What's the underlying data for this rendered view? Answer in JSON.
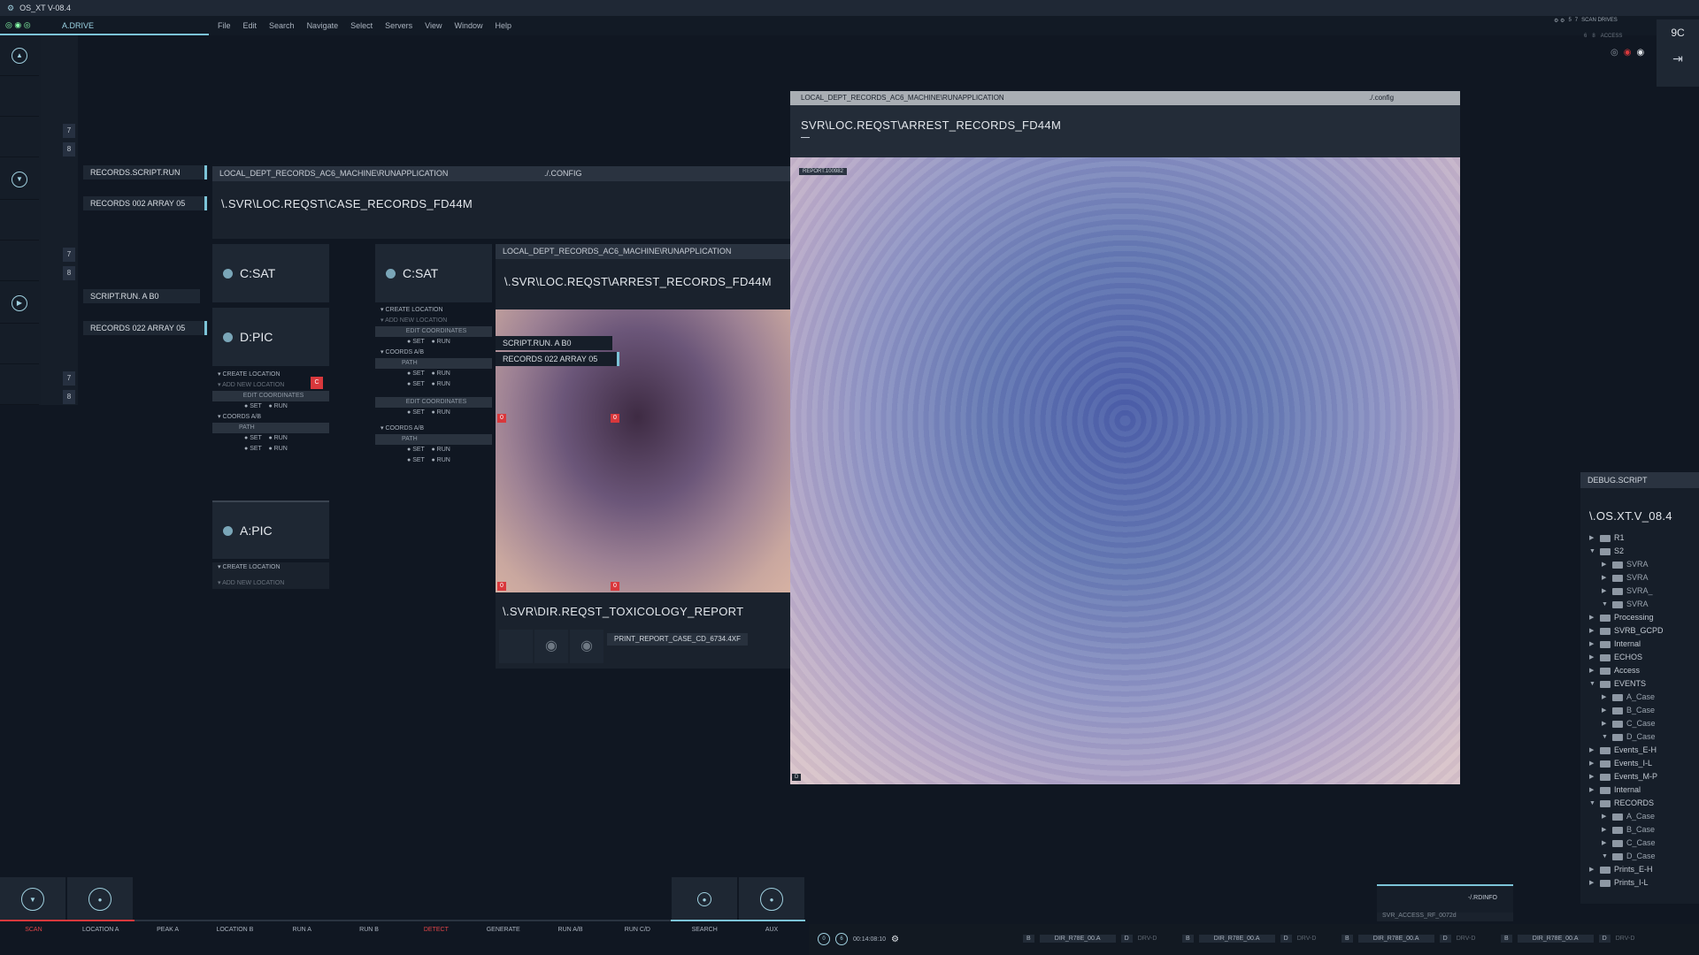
{
  "app": {
    "title": "OS_XT V-08.4",
    "drive": "A.DRIVE",
    "counter": "9C"
  },
  "menu": [
    "File",
    "Edit",
    "Search",
    "Navigate",
    "Select",
    "Servers",
    "View",
    "Window",
    "Help"
  ],
  "rail": {
    "numbers": [
      "7",
      "8",
      "7",
      "8",
      "7",
      "8"
    ],
    "icons": [
      "triangle-up-icon",
      "triangle-down-icon",
      "play-icon"
    ]
  },
  "tags": [
    "RECORDS.SCRIPT.RUN",
    "RECORDS 002 ARRAY 05",
    "SCRIPT.RUN. A B0",
    "RECORDS 022 ARRAY 05"
  ],
  "panelA": {
    "path": "LOCAL_DEPT_RECORDS_AC6_MACHINE\\RUNAPPLICATION",
    "config": "./.CONFIG",
    "title": "\\.SVR\\LOC.REQST\\CASE_RECORDS_FD44M"
  },
  "drives": [
    "C:SAT",
    "D:PIC",
    "A:PIC",
    "C:SAT"
  ],
  "controls": {
    "create": "CREATE LOCATION",
    "add": "ADD NEW LOCATION",
    "edit": "EDIT COORDINATES",
    "set": "SET",
    "run": "RUN",
    "coords": "COORDS A/B",
    "path": "PATH",
    "c": "C"
  },
  "panelB": {
    "path": "LOCAL_DEPT_RECORDS_AC6_MACHINE\\RUNAPPLICATION",
    "title": "\\.SVR\\LOC.REQST\\ARREST_RECORDS_FD44M",
    "tag1": "SCRIPT.RUN. A B0",
    "tag2": "RECORDS 022 ARRAY 05",
    "zero": "0"
  },
  "tox": {
    "title": "\\.SVR\\DIR.REQST_TOXICOLOGY_REPORT",
    "file": "PRINT_REPORT_CASE_CD_6734.4XF"
  },
  "viewer": {
    "path": "LOCAL_DEPT_RECORDS_AC6_MACHINE\\RUNAPPLICATION",
    "config": "./.config",
    "title": "SVR\\LOC.REQST\\ARREST_RECORDS_FD44M",
    "tag": "REPORT.100982",
    "d": "D"
  },
  "top_right": {
    "scan": "SCAN DRIVES",
    "access": "ACCESS",
    "n": [
      "5",
      "7",
      "6",
      "8"
    ]
  },
  "debug": {
    "label": "DEBUG.SCRIPT",
    "title": "\\.OS.XT.V_08.4"
  },
  "tree": [
    {
      "l": 0,
      "t": "▶",
      "n": "R1"
    },
    {
      "l": 0,
      "t": "▼",
      "n": "S2"
    },
    {
      "l": 1,
      "t": "▶",
      "n": "SVRA"
    },
    {
      "l": 1,
      "t": "▶",
      "n": "SVRA"
    },
    {
      "l": 1,
      "t": "▶",
      "n": "SVRA_"
    },
    {
      "l": 1,
      "t": "▼",
      "n": "SVRA"
    },
    {
      "l": 0,
      "t": "▶",
      "n": "Processing"
    },
    {
      "l": 0,
      "t": "▶",
      "n": "SVRB_GCPD"
    },
    {
      "l": 0,
      "t": "▶",
      "n": "Internal"
    },
    {
      "l": 0,
      "t": "▶",
      "n": "ECHOS"
    },
    {
      "l": 0,
      "t": "▶",
      "n": "Access"
    },
    {
      "l": 0,
      "t": "▼",
      "n": "EVENTS"
    },
    {
      "l": 1,
      "t": "▶",
      "n": "A_Case"
    },
    {
      "l": 1,
      "t": "▶",
      "n": "B_Case"
    },
    {
      "l": 1,
      "t": "▶",
      "n": "C_Case"
    },
    {
      "l": 1,
      "t": "▼",
      "n": "D_Case"
    },
    {
      "l": 0,
      "t": "▶",
      "n": "Events_E-H"
    },
    {
      "l": 0,
      "t": "▶",
      "n": "Events_I-L"
    },
    {
      "l": 0,
      "t": "▶",
      "n": "Events_M-P"
    },
    {
      "l": 0,
      "t": "▶",
      "n": "Internal"
    },
    {
      "l": 0,
      "t": "▼",
      "n": "RECORDS"
    },
    {
      "l": 1,
      "t": "▶",
      "n": "A_Case"
    },
    {
      "l": 1,
      "t": "▶",
      "n": "B_Case"
    },
    {
      "l": 1,
      "t": "▶",
      "n": "C_Case"
    },
    {
      "l": 1,
      "t": "▼",
      "n": "D_Case"
    },
    {
      "l": 0,
      "t": "▶",
      "n": "Prints_E-H"
    },
    {
      "l": 0,
      "t": "▶",
      "n": "Prints_I-L"
    }
  ],
  "bottom_tabs": [
    "SCAN",
    "LOCATION A",
    "PEAK A",
    "LOCATION B",
    "RUN A",
    "RUN B",
    "DETECT",
    "GENERATE",
    "RUN A/B",
    "RUN C/D",
    "SEARCH",
    "AUX"
  ],
  "info": {
    "rdinfo": "-/.RDINFO",
    "access": "SVR_ACCESS_RF_0072d",
    "time": "00:14:08:10"
  },
  "drive_status": [
    {
      "a": "B",
      "f": "DIR_R78E_00.A",
      "b": "D",
      "s": "DRV-D"
    },
    {
      "a": "B",
      "f": "DIR_R78E_00.A",
      "b": "D",
      "s": "DRV-D"
    },
    {
      "a": "B",
      "f": "DIR_R78E_00.A",
      "b": "D",
      "s": "DRV-D"
    },
    {
      "a": "B",
      "f": "DIR_R78E_00.A",
      "b": "D",
      "s": "DRV-D"
    }
  ]
}
